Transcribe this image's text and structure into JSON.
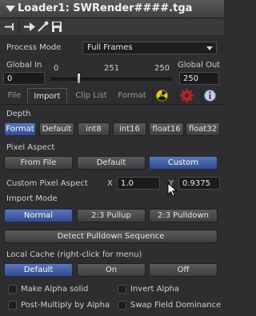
{
  "title": "Loader1: SWRender####.tga",
  "process_mode": {
    "label": "Process Mode",
    "value": "Full Frames"
  },
  "global_in": {
    "label": "Global In",
    "value": "0"
  },
  "global_out": {
    "label": "Global Out",
    "value": "250"
  },
  "slider": {
    "ticks": [
      "0",
      "251",
      "250"
    ],
    "level": 0.25
  },
  "tabs": [
    "File",
    "Import",
    "Clip List",
    "Format"
  ],
  "active_tab": "Import",
  "depth": {
    "label": "Depth",
    "options": [
      "Format",
      "Default",
      "int8",
      "int16",
      "float16",
      "float32"
    ],
    "selected": "Format"
  },
  "pixel_aspect": {
    "label": "Pixel Aspect",
    "options": [
      "From File",
      "Default",
      "Custom"
    ],
    "selected": "Custom"
  },
  "custom_pixel_aspect": {
    "label": "Custom Pixel Aspect",
    "x_label": "X",
    "x_value": "1.0",
    "y_label": "Y",
    "y_value": "0.9375"
  },
  "import_mode": {
    "label": "Import Mode",
    "options": [
      "Normal",
      "2:3 Pullup",
      "2:3 Pulldown"
    ],
    "selected": "Normal"
  },
  "detect_button": "Detect Pulldown Sequence",
  "local_cache": {
    "label": "Local Cache (right-click for menu)",
    "options": [
      "Default",
      "On",
      "Off"
    ],
    "selected": "Default"
  },
  "checkboxes": {
    "make_alpha_solid": "Make Alpha solid",
    "invert_alpha": "Invert Alpha",
    "post_multiply": "Post-Multiply by Alpha",
    "swap_field": "Swap Field Dominance"
  },
  "colors": {
    "accent": "#3d5aa0",
    "background": "#2e2e30"
  }
}
